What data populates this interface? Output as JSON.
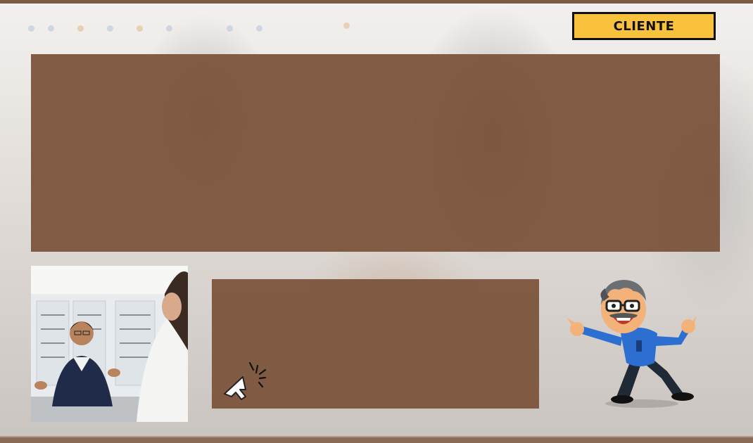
{
  "header": {
    "role_tag": "CLIENTE"
  },
  "icons": {
    "cursor": "click-cursor-icon",
    "mascot": "optician-mascot",
    "photo": "customer-photo"
  },
  "colors": {
    "panel": "#7a5239",
    "tag_bg": "#f8c23d",
    "accent_bar": "#7b5a44"
  }
}
